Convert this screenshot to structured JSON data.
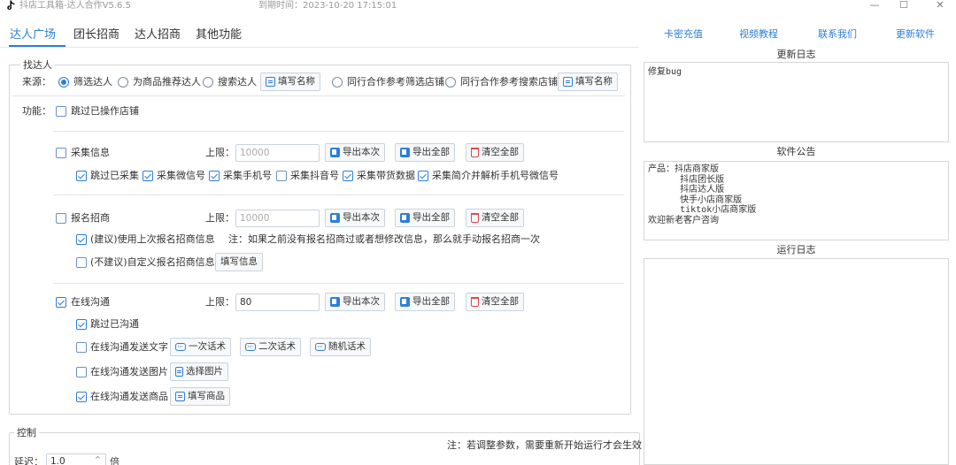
{
  "window": {
    "title": "抖店工具箱-达人合作V5.6.5",
    "expire": "到期时间：2023-10-20 17:15:01"
  },
  "nav": {
    "tabs": [
      "达人广场",
      "团长招商",
      "达人招商",
      "其他功能"
    ],
    "links": [
      "卡密充值",
      "视频教程",
      "联系我们",
      "更新软件"
    ]
  },
  "find": {
    "group_title": "找达人",
    "source_label": "来源：",
    "source_options": [
      "筛选达人",
      "为商品推荐达人",
      "搜索达人",
      "同行合作参考筛选店铺",
      "同行合作参考搜索店铺"
    ],
    "selected_source": "筛选达人",
    "fill_name_button": "填写名称",
    "function_label": "功能：",
    "skip_operated": "跳过已操作店铺",
    "collect": {
      "title": "采集信息",
      "limit_label": "上限：",
      "limit_placeholder": "10000",
      "options": [
        "跳过已采集",
        "采集微信号",
        "采集手机号",
        "采集抖音号",
        "采集带货数据",
        "采集简介并解析手机号微信号"
      ]
    },
    "signup": {
      "title": "报名招商",
      "limit_label": "上限：",
      "limit_placeholder": "10000",
      "suggest_option": "(建议)使用上次报名招商信息",
      "suggest_note": "注：如果之前没有报名招商过或者想修改信息，那么就手动报名招商一次",
      "custom_option": "(不建议)自定义报名招商信息",
      "fill_info_button": "填写信息"
    },
    "chat": {
      "title": "在线沟通",
      "limit_label": "上限：",
      "limit_value": "80",
      "skip_chatted": "跳过已沟通",
      "send_text": "在线沟通发送文字",
      "script_buttons": [
        "一次话术",
        "二次话术",
        "随机话术"
      ],
      "send_image": "在线沟通发送图片",
      "choose_image_button": "选择图片",
      "send_product": "在线沟通发送商品",
      "fill_product_button": "填写商品"
    },
    "buttons": {
      "export_this": "导出本次",
      "export_all": "导出全部",
      "clear_all": "清空全部"
    }
  },
  "control": {
    "group_title": "控制",
    "note": "注：若调整参数，需要重新开始运行才会生效",
    "delay_label": "延迟：",
    "delay_value": "1.0",
    "delay_unit": "倍"
  },
  "right": {
    "changelog_title": "更新日志",
    "changelog_text": "修复bug",
    "notice_title": "软件公告",
    "notice_text": "产品：抖店商家版\n      抖店团长版\n      抖店达人版\n      快手小店商家版\n      tiktok小店商家版\n欢迎新老客户咨询",
    "runlog_title": "运行日志"
  },
  "colors": {
    "accent": "#2b7fd8",
    "danger": "#e04a4a",
    "border": "#d6d6d6"
  }
}
